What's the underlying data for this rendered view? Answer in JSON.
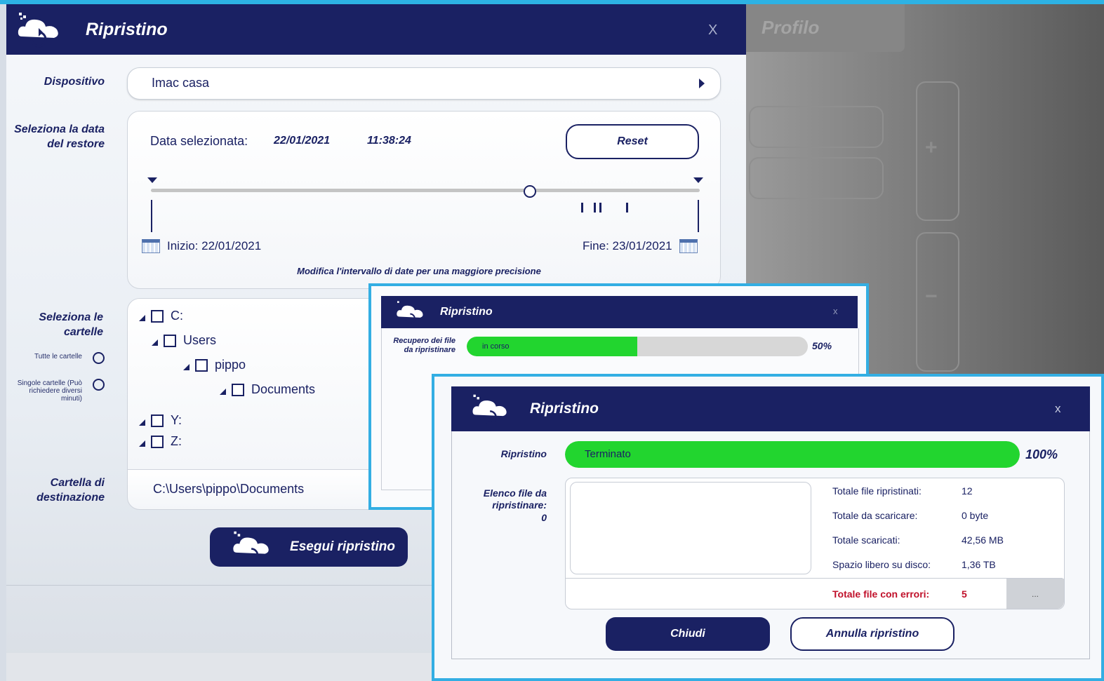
{
  "right_panel": {
    "title": "Profilo",
    "plus_icon": "+",
    "minus_icon": "−"
  },
  "main": {
    "title": "Ripristino",
    "close": "X",
    "device": {
      "label": "Dispositivo",
      "value": "Imac casa"
    },
    "date": {
      "label": "Seleziona la data del restore",
      "selected_label": "Data selezionata:",
      "selected_date": "22/01/2021",
      "selected_time": "11:38:24",
      "reset": "Reset",
      "start": "Inizio: 22/01/2021",
      "end": "Fine: 23/01/2021",
      "hint": "Modifica l'intervallo di date per una maggiore precisione",
      "slider_position": 0.69
    },
    "folders": {
      "label": "Seleziona le cartelle",
      "all_option": "Tutte le cartelle",
      "single_option": "Singole cartelle (Può richiedere diversi minuti)",
      "tree": [
        {
          "name": "C:"
        },
        {
          "name": "Users"
        },
        {
          "name": "pippo"
        },
        {
          "name": "Documents"
        },
        {
          "name": "Y:"
        },
        {
          "name": "Z:"
        }
      ]
    },
    "destination": {
      "label": "Cartella di destinazione",
      "value": "C:\\Users\\pippo\\Documents"
    },
    "execute_button": "Esegui ripristino"
  },
  "dialog_progress": {
    "title": "Ripristino",
    "close": "x",
    "label": "Recupero dei file da ripristinare",
    "status": "in corso",
    "percent_text": "50%",
    "progress": 0.5
  },
  "dialog_done": {
    "title": "Ripristino",
    "close": "x",
    "progress_label": "Ripristino",
    "status": "Terminato",
    "percent_text": "100%",
    "progress": 1.0,
    "list_label": "Elenco file da ripristinare:",
    "list_count": "0",
    "stats": [
      {
        "label": "Totale file ripristinati:",
        "value": "12"
      },
      {
        "label": "Totale da scaricare:",
        "value": "0 byte"
      },
      {
        "label": "Totale scaricati:",
        "value": "42,56 MB"
      },
      {
        "label": "Spazio libero su disco:",
        "value": "1,36 TB"
      }
    ],
    "errors": {
      "label": "Totale file con errori:",
      "value": "5",
      "more": "..."
    },
    "close_button": "Chiudi",
    "cancel_button": "Annulla ripristino"
  },
  "colors": {
    "navy": "#1a2163",
    "accent": "#33aee3",
    "progress": "#22d52f",
    "error": "#c0102a"
  }
}
